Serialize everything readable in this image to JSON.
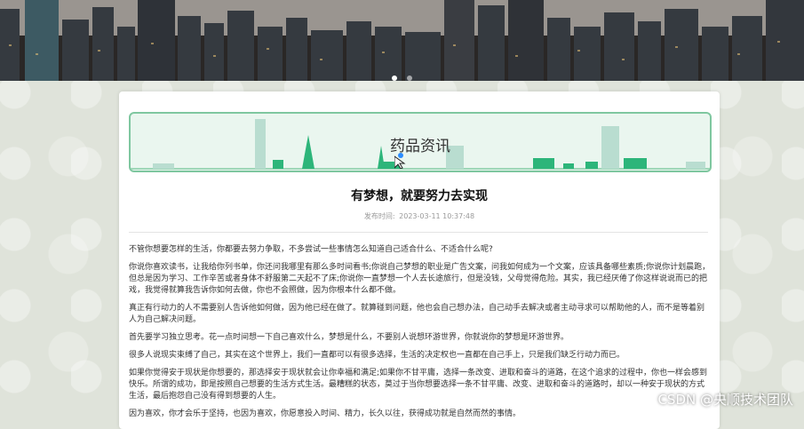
{
  "banner": {
    "slide_count": 2,
    "active_slide": 1
  },
  "section": {
    "title": "药品资讯",
    "accent_color": "#2db57a"
  },
  "article": {
    "title": "有梦想，就要努力去实现",
    "published_label": "发布时间:",
    "published_time": "2023-03-11 10:37:48",
    "paragraphs": [
      "不管你想要怎样的生活，你都要去努力争取，不多尝试一些事情怎么知道自己适合什么、不适合什么呢?",
      "你说你喜欢读书，让我给你列书单，你还问我哪里有那么多时间看书;你说自己梦想的职业是广告文案，问我如何成为一个文案，应该具备哪些素质;你说你计划晨跑，但总是因为学习、工作辛苦或者身体不舒服第二天起不了床;你说你一直梦想一个人去长途旅行，但是没钱，父母觉得危险。其实，我已经厌倦了你这样说说而已的把戏，我觉得就算我告诉你如何去做，你也不会照做，因为你根本什么都不做。",
      "真正有行动力的人不需要别人告诉他如何做，因为他已经在做了。就算碰到问题，他也会自己想办法，自己动手去解决或者主动寻求可以帮助他的人，而不是等着别人为自己解决问题。",
      "首先要学习独立思考。花一点时间想一下自己喜欢什么，梦想是什么，不要别人说想环游世界，你就说你的梦想是环游世界。",
      "很多人说现实束缚了自己，其实在这个世界上，我们一直都可以有很多选择，生活的决定权也一直都在自己手上，只是我们缺乏行动力而已。",
      "如果你觉得安于现状是你想要的，那选择安于现状就会让你幸福和满足;如果你不甘平庸，选择一条改变、进取和奋斗的道路，在这个追求的过程中，你也一样会感到快乐。所谓的成功，即是按照自己想要的生活方式生活。最糟糕的状态，莫过于当你想要选择一条不甘平庸、改变、进取和奋斗的道路时，却以一种安于现状的方式生活，最后抱怨自己没有得到想要的人生。",
      "因为喜欢，你才会乐于坚持，也因为喜欢，你愿意投入时间、精力，长久以往，获得成功就是自然而然的事情。"
    ]
  },
  "watermark": "CSDN @央顺技术团队"
}
